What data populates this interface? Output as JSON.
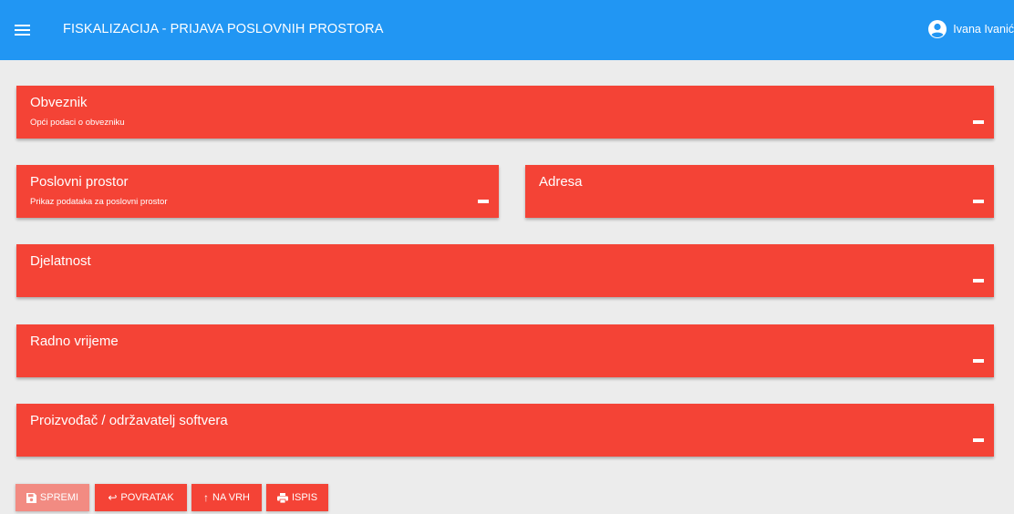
{
  "header": {
    "menu_icon": "hamburger-menu-icon",
    "title": "FISKALIZACIJA - PRIJAVA POSLOVNIH PROSTORA",
    "user_icon": "account-circle-icon",
    "user_name": "Ivana Ivanić",
    "color": "#2196f3"
  },
  "sections": {
    "obveznik": {
      "title": "Obveznik",
      "subtitle": "Opći podaci o obvezniku"
    },
    "poslovni_prostor": {
      "title": "Poslovni prostor",
      "subtitle": "Prikaz podataka za poslovni prostor"
    },
    "adresa": {
      "title": "Adresa",
      "subtitle": ""
    },
    "djelatnost": {
      "title": "Djelatnost",
      "subtitle": ""
    },
    "radno_vrijeme": {
      "title": "Radno vrijeme",
      "subtitle": ""
    },
    "proizvodac": {
      "title": "Proizvođač / održavatelj softvera",
      "subtitle": ""
    },
    "collapse_icon": "minus-icon",
    "color": "#f44336"
  },
  "actions": {
    "spremi": {
      "label": "SPREMI",
      "icon": "save-icon",
      "disabled": true
    },
    "povratak": {
      "label": "POVRATAK",
      "icon": "↩"
    },
    "na_vrh": {
      "label": "NA VRH",
      "icon": "↑"
    },
    "ispis": {
      "label": "ISPIS",
      "icon": "print-icon"
    }
  }
}
